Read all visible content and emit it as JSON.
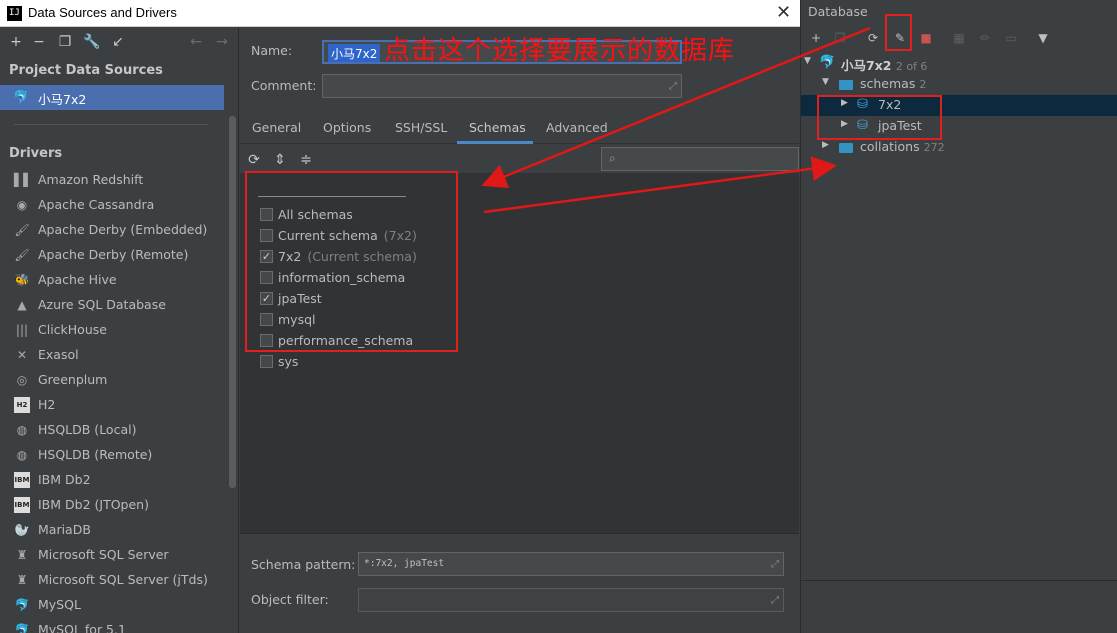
{
  "dialog": {
    "title": "Data Sources and Drivers",
    "app_icon_text": "IJ",
    "close_glyph": "✕"
  },
  "left": {
    "toolbar_icons": [
      "plus-icon",
      "minus-icon",
      "duplicate-icon",
      "wrench-icon",
      "import-icon",
      "back-icon",
      "forward-icon"
    ],
    "project_section": "Project Data Sources",
    "project_item": "小马7x2",
    "drivers_section": "Drivers",
    "drivers": [
      {
        "label": "Amazon Redshift",
        "icon": "redshift-icon",
        "glyph": "▌▌"
      },
      {
        "label": "Apache Cassandra",
        "icon": "cassandra-icon",
        "glyph": "◉"
      },
      {
        "label": "Apache Derby (Embedded)",
        "icon": "derby-icon",
        "glyph": "🖌"
      },
      {
        "label": "Apache Derby (Remote)",
        "icon": "derby-icon",
        "glyph": "🖌"
      },
      {
        "label": "Apache Hive",
        "icon": "hive-icon",
        "glyph": "🐝"
      },
      {
        "label": "Azure SQL Database",
        "icon": "azure-icon",
        "glyph": "▲"
      },
      {
        "label": "ClickHouse",
        "icon": "clickhouse-icon",
        "glyph": "|||"
      },
      {
        "label": "Exasol",
        "icon": "exasol-icon",
        "glyph": "✕"
      },
      {
        "label": "Greenplum",
        "icon": "greenplum-icon",
        "glyph": "◎"
      },
      {
        "label": "H2",
        "icon": "h2-icon",
        "glyph": "H2",
        "box": true
      },
      {
        "label": "HSQLDB (Local)",
        "icon": "hsqldb-icon",
        "glyph": "◍"
      },
      {
        "label": "HSQLDB (Remote)",
        "icon": "hsqldb-icon",
        "glyph": "◍"
      },
      {
        "label": "IBM Db2",
        "icon": "ibm-db2-icon",
        "glyph": "IBM",
        "box": true
      },
      {
        "label": "IBM Db2 (JTOpen)",
        "icon": "ibm-db2-icon",
        "glyph": "IBM",
        "box": true
      },
      {
        "label": "MariaDB",
        "icon": "mariadb-icon",
        "glyph": "🦭"
      },
      {
        "label": "Microsoft SQL Server",
        "icon": "mssql-icon",
        "glyph": "♜"
      },
      {
        "label": "Microsoft SQL Server (jTds)",
        "icon": "mssql-icon",
        "glyph": "♜"
      },
      {
        "label": "MySQL",
        "icon": "mysql-icon",
        "glyph": "🐬"
      },
      {
        "label": "MySQL for 5.1",
        "icon": "mysql-icon",
        "glyph": "🐬"
      }
    ]
  },
  "form": {
    "name_label": "Name:",
    "name_value": "小马7x2",
    "comment_label": "Comment:",
    "tabs": [
      "General",
      "Options",
      "SSH/SSL",
      "Schemas",
      "Advanced"
    ],
    "active_tab": "Schemas",
    "schemas": [
      {
        "label": "All schemas",
        "hint": "",
        "checked": false
      },
      {
        "label": "Current schema",
        "hint": "(7x2)",
        "checked": false
      },
      {
        "label": "7x2",
        "hint": "(Current schema)",
        "checked": true
      },
      {
        "label": "information_schema",
        "hint": "",
        "checked": false
      },
      {
        "label": "jpaTest",
        "hint": "",
        "checked": true
      },
      {
        "label": "mysql",
        "hint": "",
        "checked": false
      },
      {
        "label": "performance_schema",
        "hint": "",
        "checked": false
      },
      {
        "label": "sys",
        "hint": "",
        "checked": false
      }
    ],
    "schema_pattern_label": "Schema pattern:",
    "schema_pattern_value": "*:7x2, jpaTest",
    "object_filter_label": "Object filter:",
    "check_glyph": "✓"
  },
  "database": {
    "title": "Database",
    "root": {
      "label": "小马7x2",
      "count": "2 of 6"
    },
    "schemas_node": {
      "label": "schemas",
      "count": "2"
    },
    "schema_items": [
      "7x2",
      "jpaTest"
    ],
    "collations_node": {
      "label": "collations",
      "count": "272"
    }
  },
  "annotation": {
    "text": "点击这个选择要展示的数据库",
    "color": "#e02020"
  }
}
